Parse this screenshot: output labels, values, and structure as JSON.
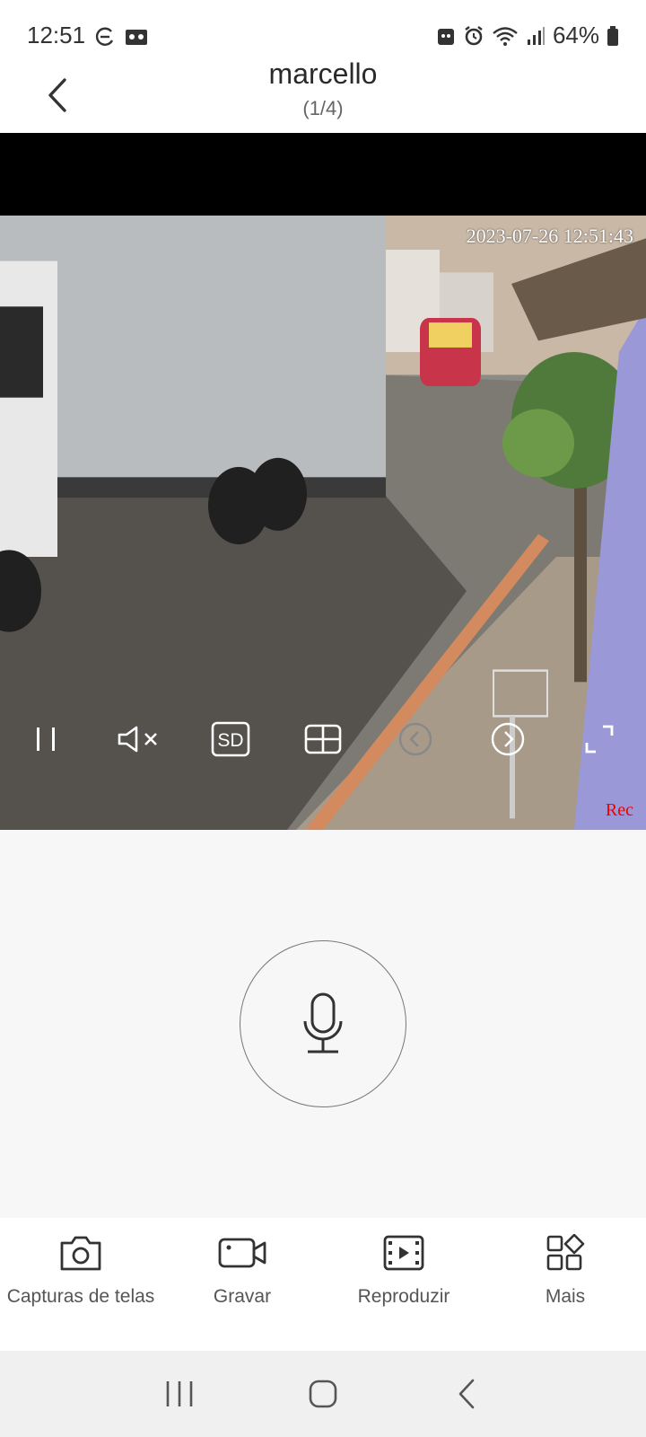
{
  "status": {
    "time": "12:51",
    "battery": "64%"
  },
  "header": {
    "title": "marcello",
    "subtitle": "(1/4)"
  },
  "video": {
    "timestamp": "2023-07-26 12:51:43",
    "rec_label": "Rec",
    "controls": [
      {
        "name": "pause-icon"
      },
      {
        "name": "mute-icon"
      },
      {
        "name": "sd-quality-icon",
        "label": "SD"
      },
      {
        "name": "grid-view-icon"
      },
      {
        "name": "previous-camera-icon"
      },
      {
        "name": "next-camera-icon"
      },
      {
        "name": "fullscreen-icon"
      }
    ]
  },
  "actions": [
    {
      "label": "Capturas de telas",
      "icon": "camera-icon"
    },
    {
      "label": "Gravar",
      "icon": "video-record-icon"
    },
    {
      "label": "Reproduzir",
      "icon": "playback-icon"
    },
    {
      "label": "Mais",
      "icon": "more-apps-icon"
    }
  ],
  "colors": {
    "rec": "#ee0000",
    "accent": "#222222"
  }
}
